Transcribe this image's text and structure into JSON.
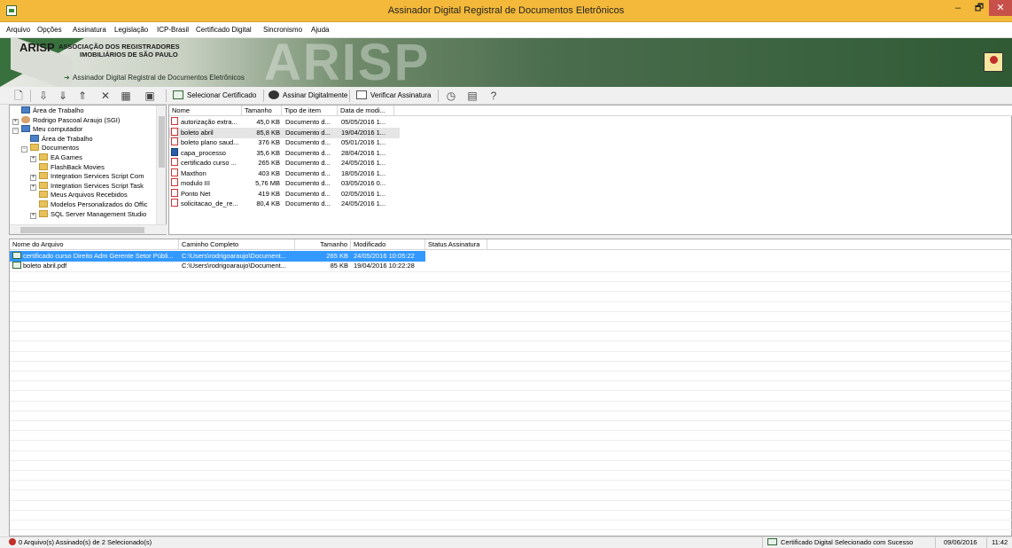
{
  "window": {
    "title": "Assinador Digital Registral de Documentos Eletrônicos",
    "minimize": "–",
    "maximize": "🗗",
    "close": "✕"
  },
  "menu": [
    "Arquivo",
    "Opções",
    "Assinatura",
    "Legislação",
    "ICP-Brasil",
    "Certificado Digital",
    "Sincronismo",
    "Ajuda"
  ],
  "banner": {
    "logo": "ARISP",
    "assoc_line1": "ASSOCIAÇÃO DOS REGISTRADORES",
    "assoc_line2": "IMOBILIÁRIOS DE SÃO PAULO",
    "watermark": "ARISP",
    "subtitle": "Assinador Digital Registral de Documentos Eletrônicos"
  },
  "toolbar": {
    "select_cert": "Selecionar Certificado",
    "sign": "Assinar Digitalmente",
    "verify": "Verificar Assinatura"
  },
  "tree": [
    {
      "label": "Área de Trabalho",
      "icon": "desktop",
      "indent": 0,
      "exp": ""
    },
    {
      "label": "Rodrigo Pascoal Araujo (SGI)",
      "icon": "user",
      "indent": 0,
      "exp": "+"
    },
    {
      "label": "Meu computador",
      "icon": "computer",
      "indent": 0,
      "exp": "−"
    },
    {
      "label": "Área de Trabalho",
      "icon": "desktop",
      "indent": 1,
      "exp": ""
    },
    {
      "label": "Documentos",
      "icon": "folder",
      "indent": 1,
      "exp": "−"
    },
    {
      "label": "EA Games",
      "icon": "folder",
      "indent": 2,
      "exp": "+"
    },
    {
      "label": "FlashBack Movies",
      "icon": "folder",
      "indent": 2,
      "exp": ""
    },
    {
      "label": "Integration Services Script Com",
      "icon": "folder",
      "indent": 2,
      "exp": "+"
    },
    {
      "label": "Integration Services Script Task",
      "icon": "folder",
      "indent": 2,
      "exp": "+"
    },
    {
      "label": "Meus Arquivos Recebidos",
      "icon": "folder",
      "indent": 2,
      "exp": ""
    },
    {
      "label": "Modelos Personalizados do Offic",
      "icon": "folder",
      "indent": 2,
      "exp": ""
    },
    {
      "label": "SQL Server Management Studio",
      "icon": "folder",
      "indent": 2,
      "exp": "+"
    }
  ],
  "filelist": {
    "headers": [
      "Nome",
      "Tamanho",
      "Tipo de item",
      "Data de modi..."
    ],
    "rows": [
      {
        "name": "autorização extra...",
        "size": "45,0 KB",
        "type": "Documento d...",
        "date": "05/05/2016 1...",
        "icon": "pdf"
      },
      {
        "name": "boleto abril",
        "size": "85,8 KB",
        "type": "Documento d...",
        "date": "19/04/2016 1...",
        "icon": "pdf"
      },
      {
        "name": "boleto plano saud...",
        "size": "376 KB",
        "type": "Documento d...",
        "date": "05/01/2016 1...",
        "icon": "pdf"
      },
      {
        "name": "capa_processo",
        "size": "35,6 KB",
        "type": "Documento d...",
        "date": "28/04/2016 1...",
        "icon": "doc"
      },
      {
        "name": "certificado curso ...",
        "size": "265 KB",
        "type": "Documento d...",
        "date": "24/05/2016 1...",
        "icon": "pdf"
      },
      {
        "name": "Maxthon",
        "size": "403 KB",
        "type": "Documento d...",
        "date": "18/05/2016 1...",
        "icon": "pdf"
      },
      {
        "name": "modulo III",
        "size": "5,76 MB",
        "type": "Documento d...",
        "date": "03/05/2016 0...",
        "icon": "pdf"
      },
      {
        "name": "Ponto Net",
        "size": "419 KB",
        "type": "Documento d...",
        "date": "02/05/2016 1...",
        "icon": "pdf"
      },
      {
        "name": "solicitacao_de_re...",
        "size": "80,4 KB",
        "type": "Documento d...",
        "date": "24/05/2016 1...",
        "icon": "pdf"
      }
    ]
  },
  "selected": {
    "headers": [
      "Nome do Arquivo",
      "Caminho Completo",
      "Tamanho",
      "Modificado",
      "Status Assinatura"
    ],
    "rows": [
      {
        "name": "certificado curso Direito Adm Gerente Setor Públi...",
        "path": "C:\\Users\\rodrigoaraujo\\Document...",
        "size": "265 KB",
        "modified": "24/05/2016 10:05:22",
        "status": ""
      },
      {
        "name": "boleto abril.pdf",
        "path": "C:\\Users\\rodrigoaraujo\\Document...",
        "size": "85 KB",
        "modified": "19/04/2016 10:22:28",
        "status": ""
      }
    ]
  },
  "status": {
    "signed": "0 Arquivo(s) Assinado(s) de 2 Selecionado(s)",
    "cert": "Certificado Digital Selecionado com Sucesso",
    "date": "09/06/2016",
    "time": "11:42"
  }
}
